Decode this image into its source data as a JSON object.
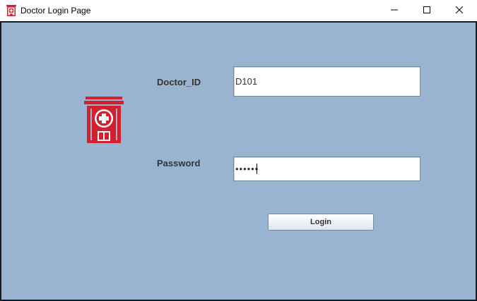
{
  "window": {
    "title": "Doctor Login Page",
    "icon": "hospital-icon",
    "controls": {
      "minimize": "minimize-icon",
      "maximize": "maximize-icon",
      "close": "close-icon"
    }
  },
  "form": {
    "background_color": "#99b4d1",
    "accent_color": "#d4202e",
    "logo_icon": "hospital-icon",
    "doctor_id_label": "Doctor_ID",
    "doctor_id_value": "D101",
    "password_label": "Password",
    "password_value": "••••••",
    "login_label": "Login"
  }
}
